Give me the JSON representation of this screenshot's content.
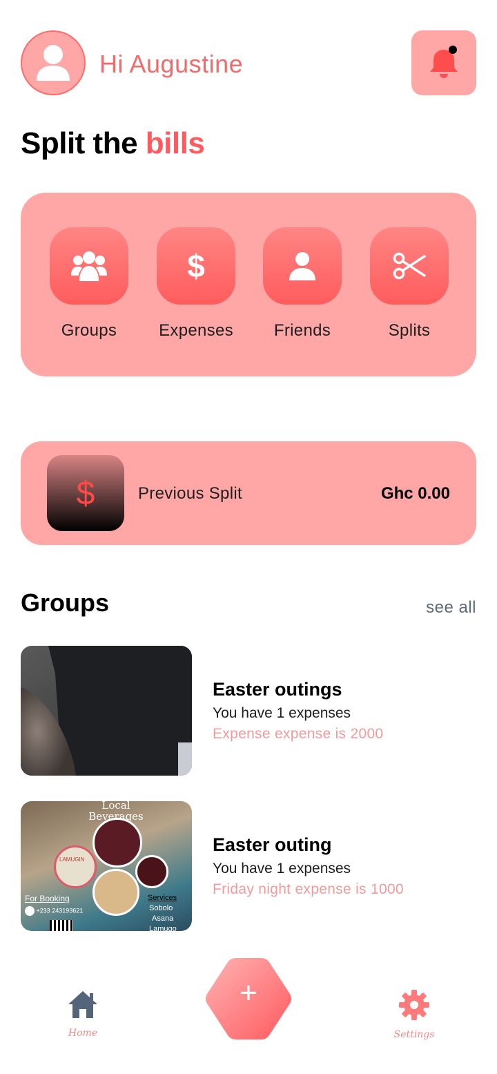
{
  "header": {
    "greeting": "Hi Augustine"
  },
  "hero": {
    "title_plain": "Split the",
    "title_accent": "bills"
  },
  "actions": [
    {
      "label": "Groups",
      "icon": "users-icon"
    },
    {
      "label": "Expenses",
      "icon": "dollar-icon"
    },
    {
      "label": "Friends",
      "icon": "user-icon"
    },
    {
      "label": "Splits",
      "icon": "scissors-icon"
    }
  ],
  "previous_split": {
    "label": "Previous Split",
    "amount": "Ghc 0.00",
    "icon": "$"
  },
  "groups_section": {
    "title": "Groups",
    "see_all": "see all",
    "items": [
      {
        "name": "Easter outings",
        "count": "You have 1 expenses",
        "total": "Expense expense is 2000"
      },
      {
        "name": "Easter outing",
        "count": "You have 1 expenses",
        "total": "Friday night expense is 1000"
      }
    ]
  },
  "poster": {
    "title": "Local Beverages",
    "booking": "For Booking",
    "phone": "+233 243193621",
    "services_title": "Services",
    "services": [
      "Sobolo",
      "Asana",
      "Lamugo"
    ],
    "brand": "LAMUGIN"
  },
  "nav": {
    "home": "Home",
    "settings": "Settings",
    "add": "+"
  },
  "colors": {
    "accent": "#ff5a5f",
    "card": "#ffa7a7",
    "greeting": "#f16b6b",
    "subtle": "#f29b9b",
    "home_icon": "#54647a"
  }
}
